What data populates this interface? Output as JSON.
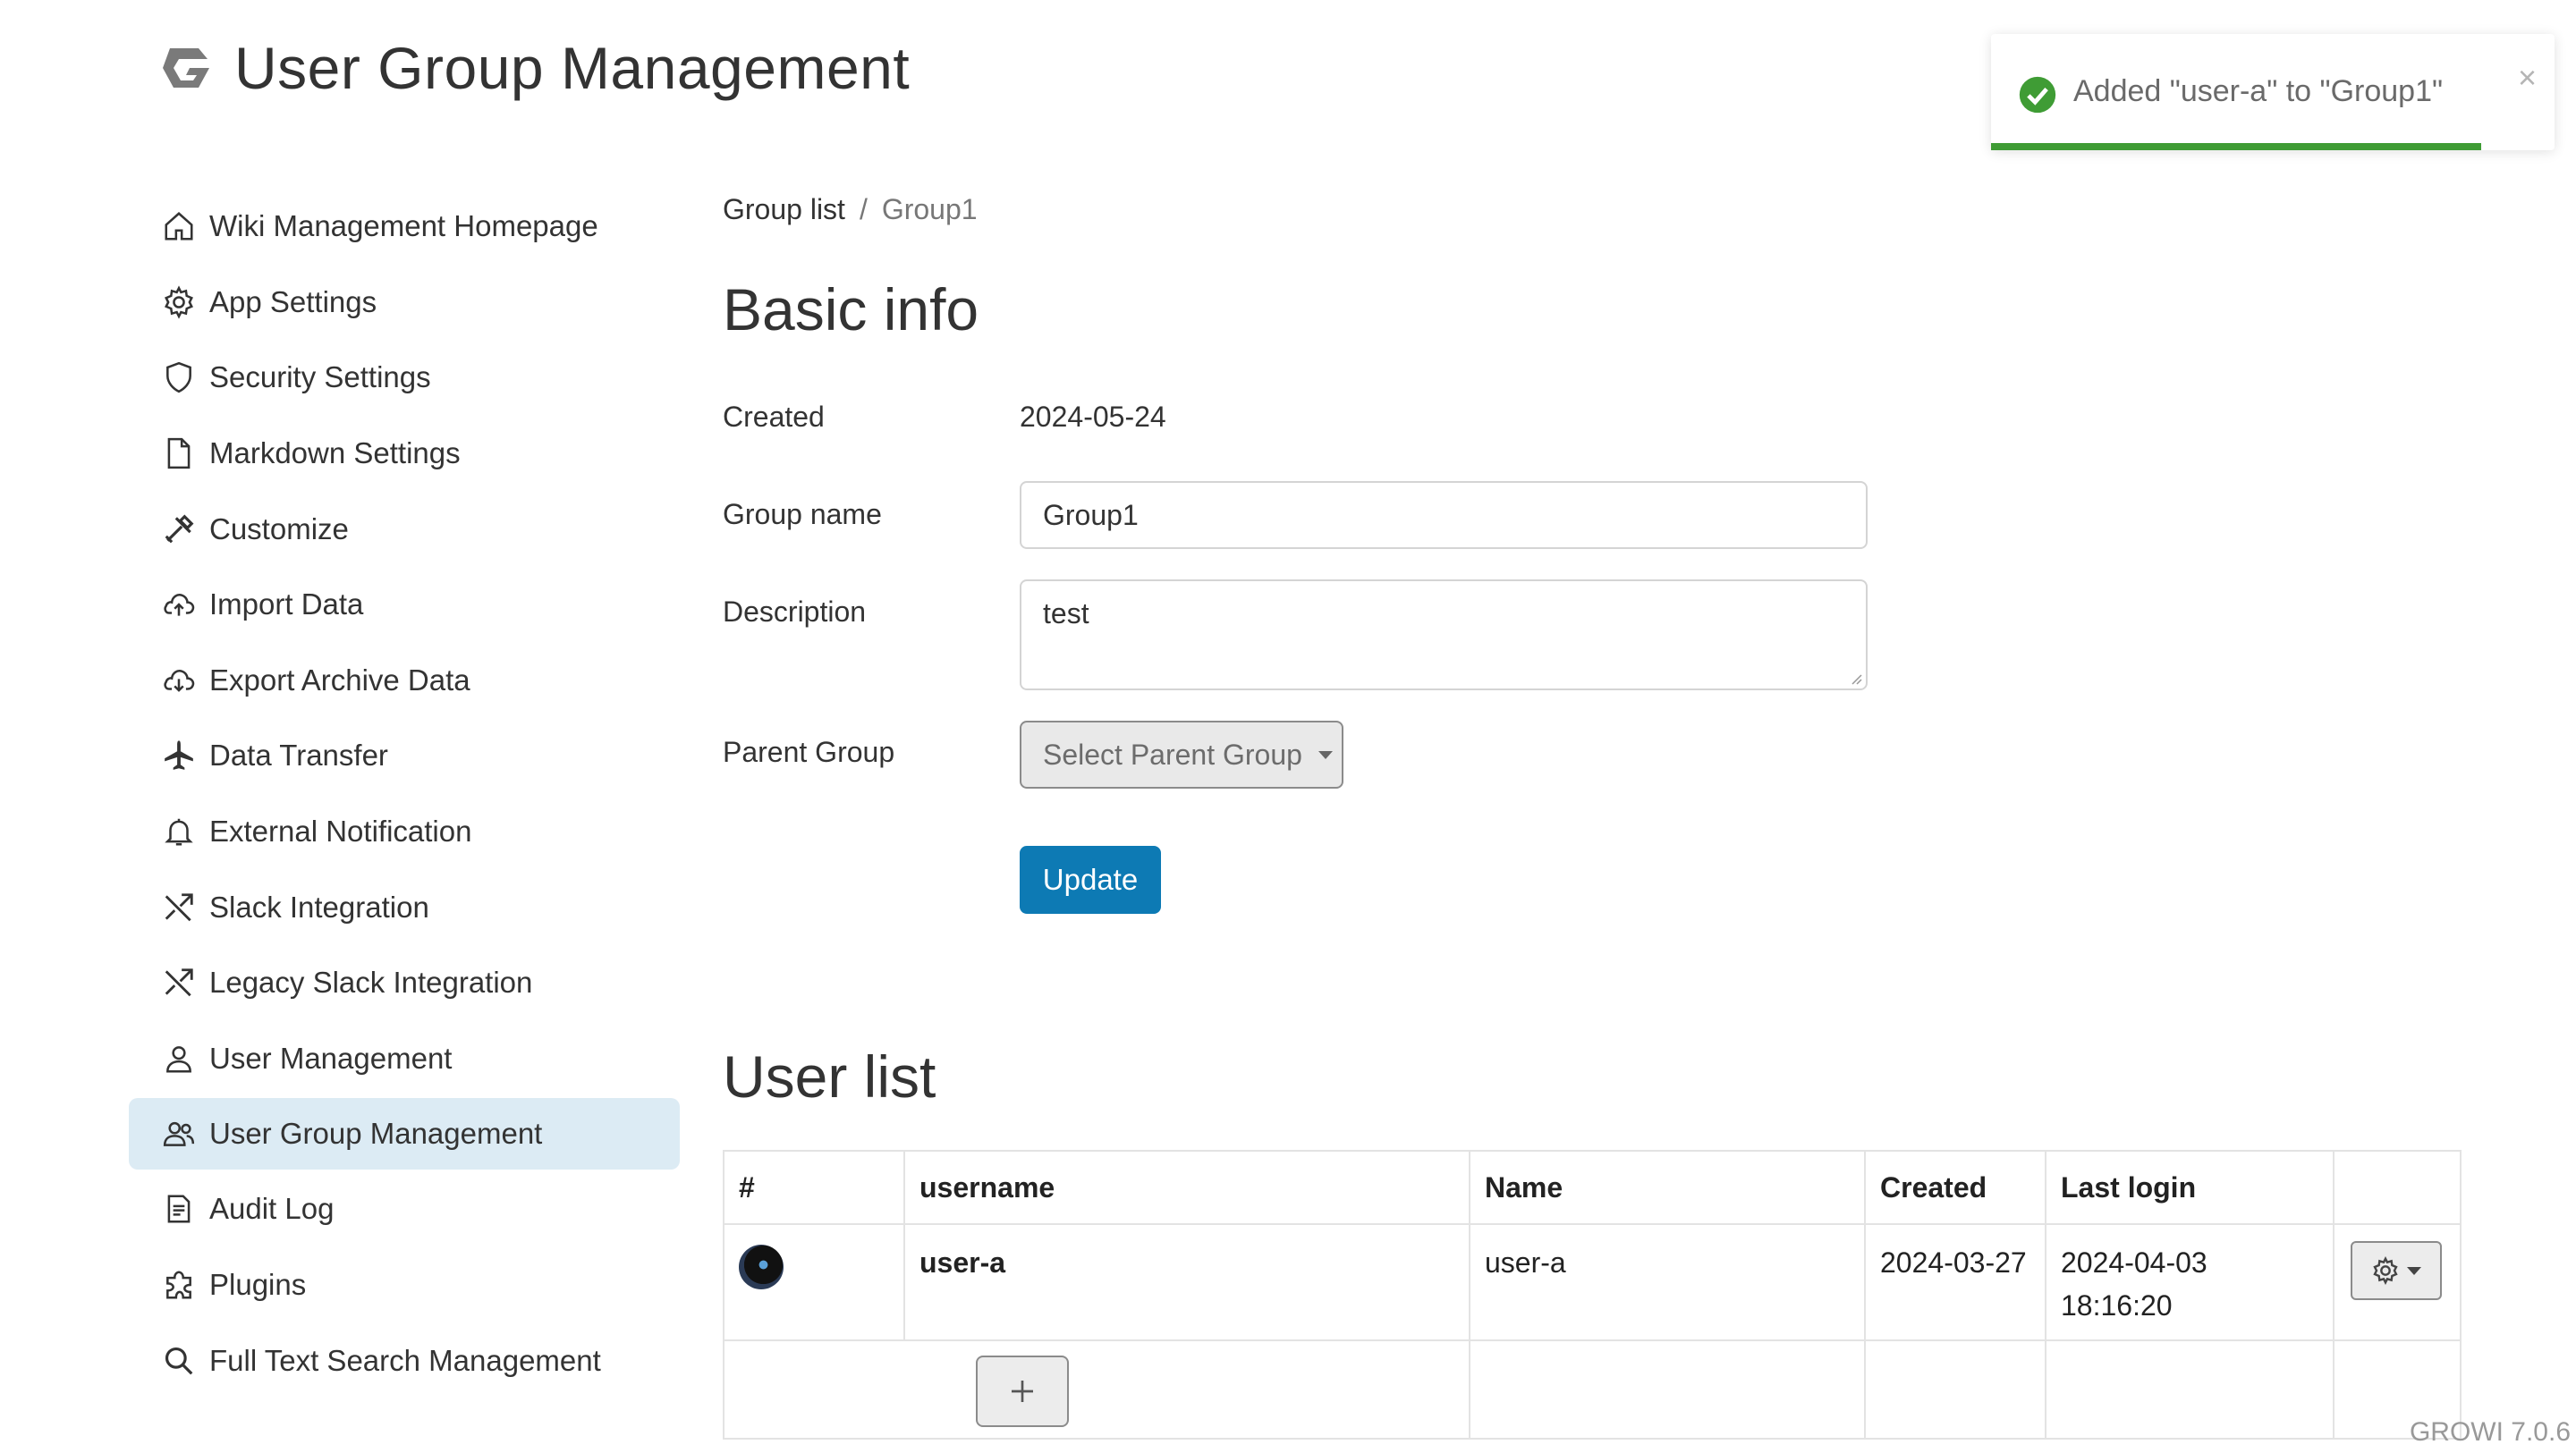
{
  "header": {
    "title": "User Group Management"
  },
  "sidebar": {
    "items": [
      {
        "label": "Wiki Management Homepage",
        "icon": "home-icon"
      },
      {
        "label": "App Settings",
        "icon": "gear-icon"
      },
      {
        "label": "Security Settings",
        "icon": "shield-icon"
      },
      {
        "label": "Markdown Settings",
        "icon": "file-icon"
      },
      {
        "label": "Customize",
        "icon": "tools-icon"
      },
      {
        "label": "Import Data",
        "icon": "cloud-upload-icon"
      },
      {
        "label": "Export Archive Data",
        "icon": "cloud-download-icon"
      },
      {
        "label": "Data Transfer",
        "icon": "airplane-icon"
      },
      {
        "label": "External Notification",
        "icon": "bell-icon"
      },
      {
        "label": "Slack Integration",
        "icon": "shuffle-icon"
      },
      {
        "label": "Legacy Slack Integration",
        "icon": "shuffle-icon"
      },
      {
        "label": "User Management",
        "icon": "person-icon"
      },
      {
        "label": "User Group Management",
        "icon": "people-icon",
        "active": true
      },
      {
        "label": "Audit Log",
        "icon": "document-icon"
      },
      {
        "label": "Plugins",
        "icon": "puzzle-icon"
      },
      {
        "label": "Full Text Search Management",
        "icon": "search-icon"
      }
    ]
  },
  "breadcrumb": {
    "parent": "Group list",
    "separator": "/",
    "current": "Group1"
  },
  "basic_info": {
    "heading": "Basic info",
    "created_label": "Created",
    "created_value": "2024-05-24",
    "group_name_label": "Group name",
    "group_name_value": "Group1",
    "description_label": "Description",
    "description_value": "test",
    "parent_group_label": "Parent Group",
    "parent_group_select": "Select Parent Group",
    "update_button": "Update"
  },
  "user_list": {
    "heading": "User list",
    "columns": [
      "#",
      "username",
      "Name",
      "Created",
      "Last login",
      ""
    ],
    "rows": [
      {
        "username": "user-a",
        "name": "user-a",
        "created": "2024-03-27",
        "last_login": "2024-04-03 18:16:20"
      }
    ]
  },
  "toast": {
    "message": "Added \"user-a\" to \"Group1\"",
    "close": "×",
    "progress": 0.87
  },
  "footer": {
    "version": "GROWI 7.0.6"
  },
  "colors": {
    "primary": "#0d7ab4",
    "active_nav": "#dcebf4",
    "success": "#3f9c35"
  }
}
